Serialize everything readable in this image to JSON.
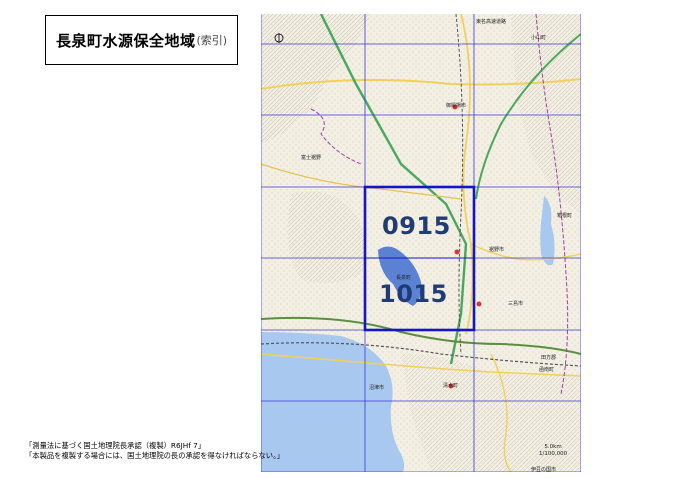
{
  "title": {
    "main": "長泉町水源保全地域",
    "sub": "(索引)"
  },
  "sheets": [
    {
      "label": "0915"
    },
    {
      "label": "1015"
    }
  ],
  "map_places": {
    "oyama": "小山町",
    "gotemba": "御殿場市",
    "hakone": "箱根町",
    "susono": "裾野市",
    "mishima": "三島市",
    "kannami": "函南町",
    "tagata": "田方郡",
    "shimizu": "清水町",
    "numazu": "沼津市",
    "nagaizumi": "長泉町",
    "izunokuni": "伊豆の国市",
    "fuji": "富士裾野",
    "expressway": "東名高速道路"
  },
  "scale": {
    "distance": "5.0km",
    "ratio": "1/100,000"
  },
  "notes": [
    "「測量法に基づく国土地理院長承認（複製）R6JHf 7」",
    "「本製品を複製する場合には、国土地理院の長の承認を得なければならない。」"
  ],
  "colors": {
    "sheet_border": "#1515c8",
    "grid": "#3a3ad8",
    "sea": "#a9c8ef",
    "land": "#f3efe4"
  }
}
